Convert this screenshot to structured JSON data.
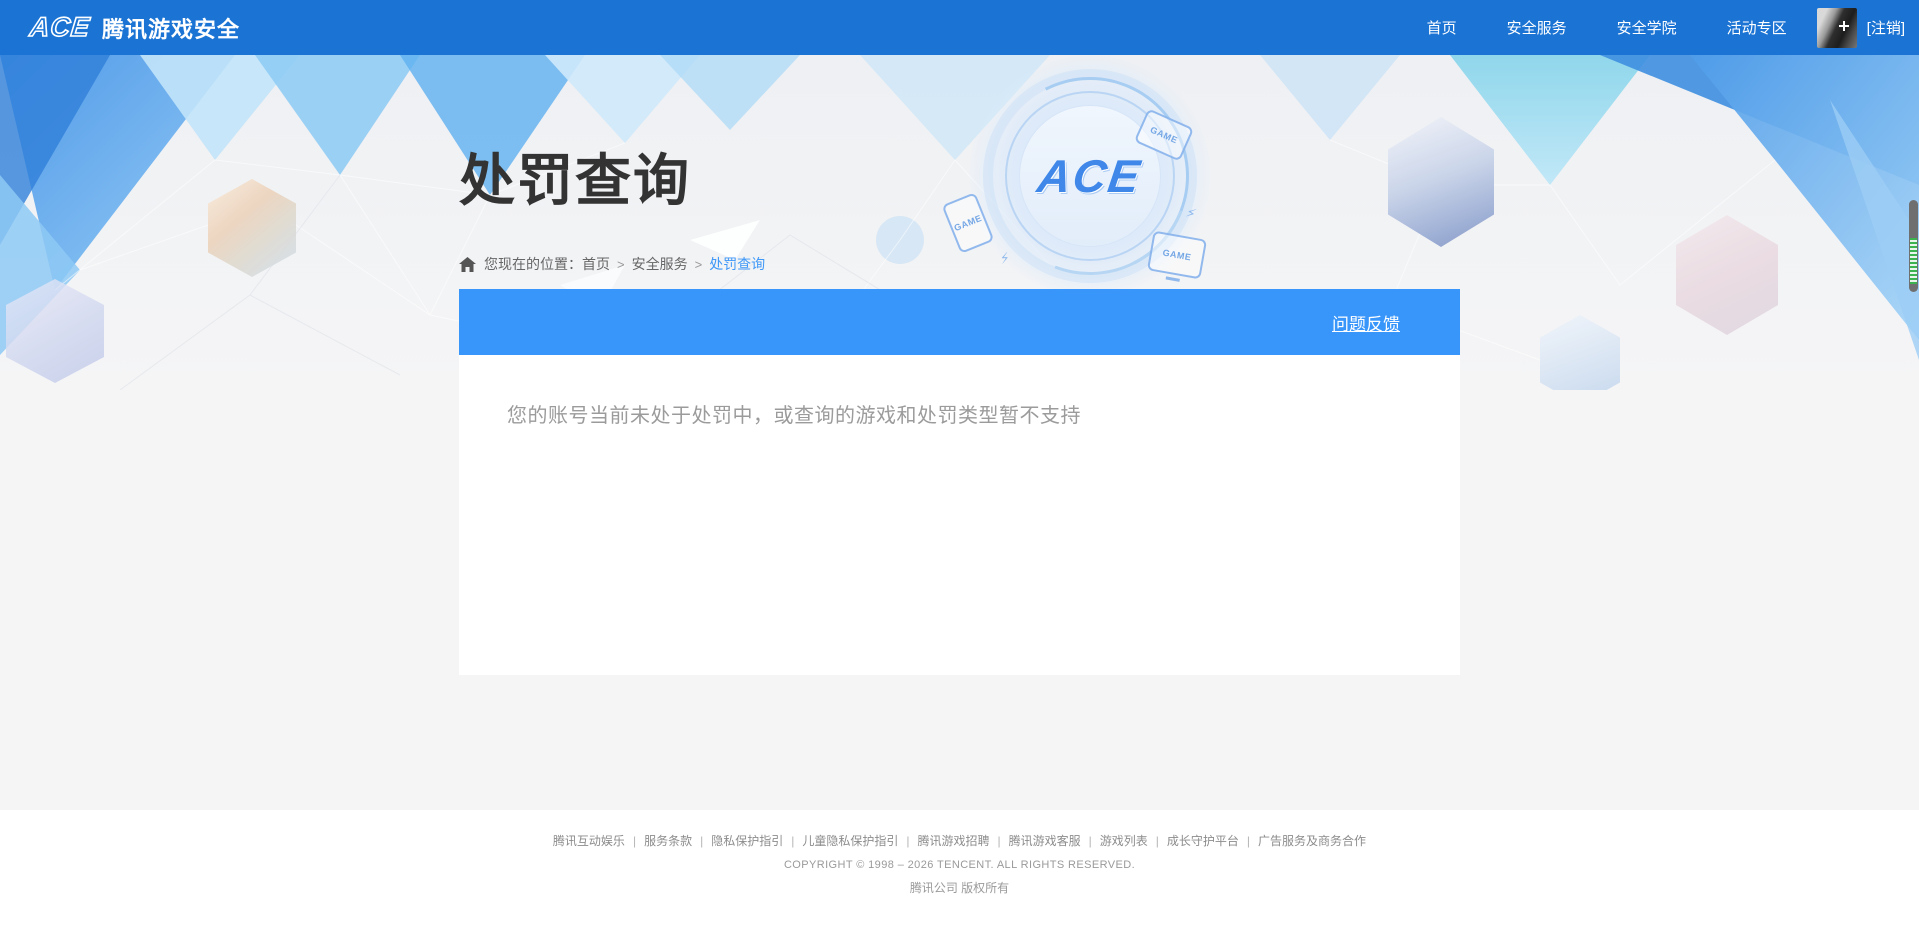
{
  "nav": {
    "logo_icon_text": "ACE",
    "logo_text": "腾讯游戏安全",
    "items": [
      "首页",
      "安全服务",
      "安全学院",
      "活动专区"
    ],
    "logout_label": "[注销]"
  },
  "hero": {
    "title": "处罚查询",
    "breadcrumb_prefix": "您现在的位置：",
    "breadcrumb_items": [
      "首页",
      "安全服务",
      "处罚查询"
    ],
    "breadcrumb_separator": ">",
    "center_logo_text": "ACE",
    "game_label": "GAME",
    "bolt_glyph": "⚡"
  },
  "panel": {
    "feedback_link": "问题反馈",
    "message": "您的账号当前未处于处罚中，或查询的游戏和处罚类型暂不支持"
  },
  "footer": {
    "links": [
      "腾讯互动娱乐",
      "服务条款",
      "隐私保护指引",
      "儿童隐私保护指引",
      "腾讯游戏招聘",
      "腾讯游戏客服",
      "游戏列表",
      "成长守护平台",
      "广告服务及商务合作"
    ],
    "separator": "|",
    "copyright_line1": "COPYRIGHT © 1998 – 2026 TENCENT. ALL RIGHTS RESERVED.",
    "copyright_line2": "腾讯公司 版权所有"
  },
  "colors": {
    "nav_blue": "#1b74d4",
    "bar_blue": "#3896fa",
    "link_blue": "#3f98f7",
    "page_bg": "#f5f5f6"
  }
}
